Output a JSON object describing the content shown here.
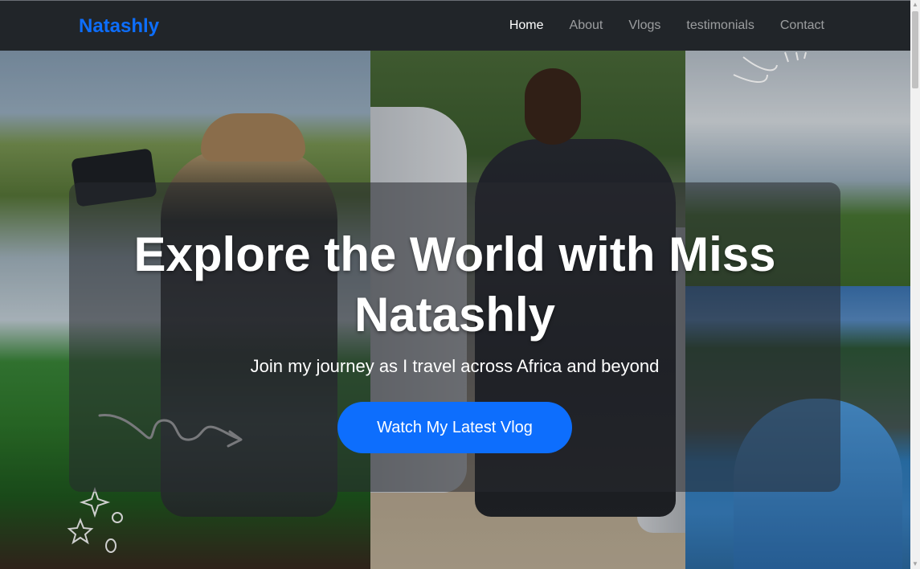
{
  "navbar": {
    "brand": "Natashly",
    "links": [
      {
        "label": "Home",
        "active": true
      },
      {
        "label": "About",
        "active": false
      },
      {
        "label": "Vlogs",
        "active": false
      },
      {
        "label": "testimonials",
        "active": false
      },
      {
        "label": "Contact",
        "active": false
      }
    ]
  },
  "hero": {
    "title": "Explore the World with Miss Natashly",
    "subtitle": "Join my journey as I travel across Africa and beyond",
    "cta_label": "Watch My Latest Vlog"
  },
  "colors": {
    "brand": "#0d6efd",
    "navbar_bg": "#212529",
    "cta_bg": "#0d6efd"
  },
  "icons": {
    "scroll_up": "▲",
    "scroll_down": "▼"
  }
}
